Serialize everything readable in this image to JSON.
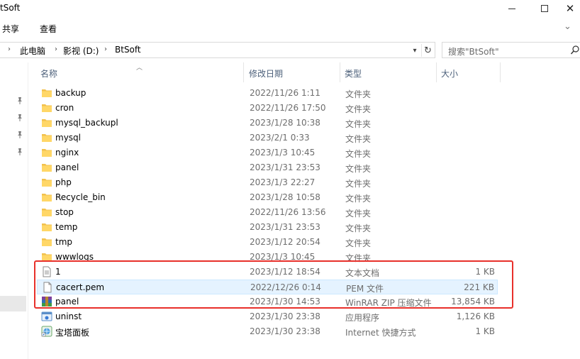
{
  "window": {
    "title": "tSoft",
    "controls": {
      "minimize": "minimize",
      "maximize": "maximize",
      "close": "close"
    }
  },
  "ribbon": {
    "tabs": [
      {
        "label": "共享"
      },
      {
        "label": "查看"
      }
    ]
  },
  "address": {
    "crumbs": [
      "此电脑",
      "影视 (D:)",
      "BtSoft"
    ]
  },
  "search": {
    "placeholder": "搜索\"BtSoft\""
  },
  "columns": {
    "name": "名称",
    "date": "修改日期",
    "type": "类型",
    "size": "大小"
  },
  "files": [
    {
      "name": "backup",
      "date": "2022/11/26 1:11",
      "type": "文件夹",
      "size": "",
      "icon": "folder-icon"
    },
    {
      "name": "cron",
      "date": "2022/11/26 17:50",
      "type": "文件夹",
      "size": "",
      "icon": "folder-icon"
    },
    {
      "name": "mysql_backupl",
      "date": "2023/1/28 10:38",
      "type": "文件夹",
      "size": "",
      "icon": "folder-icon"
    },
    {
      "name": "mysql",
      "date": "2023/2/1 0:33",
      "type": "文件夹",
      "size": "",
      "icon": "folder-icon"
    },
    {
      "name": "nginx",
      "date": "2023/1/3 10:45",
      "type": "文件夹",
      "size": "",
      "icon": "folder-icon"
    },
    {
      "name": "panel",
      "date": "2023/1/31 23:53",
      "type": "文件夹",
      "size": "",
      "icon": "folder-icon"
    },
    {
      "name": "php",
      "date": "2023/1/3 22:27",
      "type": "文件夹",
      "size": "",
      "icon": "folder-icon"
    },
    {
      "name": "Recycle_bin",
      "date": "2023/1/28 10:58",
      "type": "文件夹",
      "size": "",
      "icon": "folder-icon"
    },
    {
      "name": "stop",
      "date": "2022/11/26 13:56",
      "type": "文件夹",
      "size": "",
      "icon": "folder-icon"
    },
    {
      "name": "temp",
      "date": "2023/1/31 23:53",
      "type": "文件夹",
      "size": "",
      "icon": "folder-icon"
    },
    {
      "name": "tmp",
      "date": "2023/1/12 20:54",
      "type": "文件夹",
      "size": "",
      "icon": "folder-icon"
    },
    {
      "name": "wwwlogs",
      "date": "2023/1/3 10:45",
      "type": "文件夹",
      "size": "",
      "icon": "folder-icon"
    },
    {
      "name": "1",
      "date": "2023/1/12 18:54",
      "type": "文本文档",
      "size": "1 KB",
      "icon": "text-file-icon"
    },
    {
      "name": "cacert.pem",
      "date": "2022/12/26 0:14",
      "type": "PEM 文件",
      "size": "221 KB",
      "icon": "blank-file-icon"
    },
    {
      "name": "panel",
      "date": "2023/1/30 14:53",
      "type": "WinRAR ZIP 压缩文件",
      "size": "13,854 KB",
      "icon": "winrar-icon"
    },
    {
      "name": "uninst",
      "date": "2023/1/30 23:38",
      "type": "应用程序",
      "size": "1,126 KB",
      "icon": "app-icon"
    },
    {
      "name": "宝塔面板",
      "date": "2023/1/30 23:38",
      "type": "Internet 快捷方式",
      "size": "1 KB",
      "icon": "internet-shortcut-icon"
    }
  ],
  "colors": {
    "highlight_box": "#e8302b",
    "hover_row": "#e5f3ff",
    "folder": "#f2c14e"
  }
}
